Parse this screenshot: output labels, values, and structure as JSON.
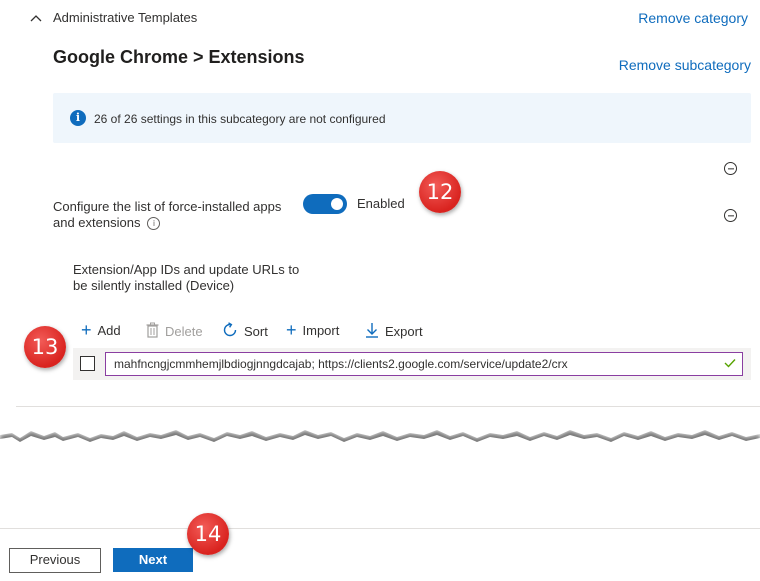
{
  "section": {
    "title": "Administrative Templates",
    "remove_category": "Remove category"
  },
  "subcategory": {
    "title": "Google Chrome > Extensions",
    "remove_subcategory": "Remove subcategory"
  },
  "info_bar": {
    "icon": "info-icon",
    "text": "26 of 26 settings in this subcategory are not configured"
  },
  "setting": {
    "label_line1": "Configure the list of force-installed apps",
    "label_line2": "and extensions",
    "toggle_state": "Enabled",
    "toggle_on": true
  },
  "sub_setting": {
    "label_line1": "Extension/App IDs and update URLs to",
    "label_line2": "be silently installed (Device)"
  },
  "toolbar": {
    "add": "Add",
    "delete": "Delete",
    "sort": "Sort",
    "import": "Import",
    "export": "Export"
  },
  "row": {
    "value": "mahfncngjcmmhemjlbdiogjnngdcajab; https://clients2.google.com/service/update2/crx",
    "valid": true
  },
  "callouts": {
    "c12": "12",
    "c13": "13",
    "c14": "14"
  },
  "footer": {
    "previous": "Previous",
    "next": "Next"
  },
  "colors": {
    "accent": "#0f6cbd",
    "callout": "#e0302b",
    "info_bg": "#eff6fc",
    "valid_check": "#57a300"
  }
}
